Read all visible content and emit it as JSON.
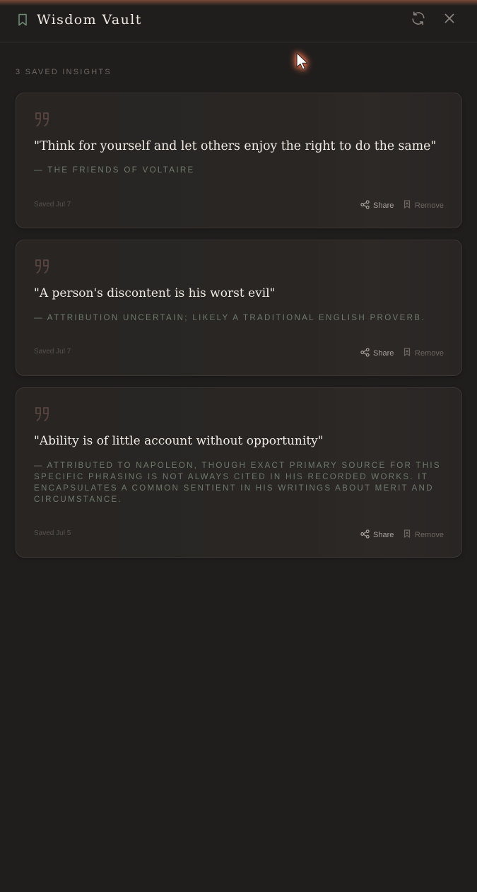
{
  "header": {
    "title": "Wisdom Vault",
    "bookmark_icon": "bookmark-icon",
    "refresh_icon": "refresh-icon",
    "close_icon": "close-icon"
  },
  "list": {
    "count_label": "3 SAVED INSIGHTS"
  },
  "quotes": [
    {
      "text": "\"Think for yourself and let others enjoy the right to do the same\"",
      "attribution": "— THE FRIENDS OF VOLTAIRE",
      "saved": "Saved Jul 7",
      "share_label": "Share",
      "remove_label": "Remove"
    },
    {
      "text": "\"A person's discontent is his worst evil\"",
      "attribution": "— ATTRIBUTION UNCERTAIN; LIKELY A TRADITIONAL ENGLISH PROVERB.",
      "saved": "Saved Jul 7",
      "share_label": "Share",
      "remove_label": "Remove"
    },
    {
      "text": "\"Ability is of little account without opportunity\"",
      "attribution": "— ATTRIBUTED TO NAPOLEON, THOUGH EXACT PRIMARY SOURCE FOR THIS SPECIFIC PHRASING IS NOT ALWAYS CITED IN HIS RECORDED WORKS. IT ENCAPSULATES A COMMON SENTIENT IN HIS WRITINGS ABOUT MERIT AND CIRCUMSTANCE.",
      "saved": "Saved Jul 5",
      "share_label": "Share",
      "remove_label": "Remove"
    }
  ],
  "colors": {
    "background": "#201e1d",
    "card_background": "#292624",
    "card_border": "#3b3633",
    "quote_text": "#f0ebe4",
    "attribution_text": "#6e7a6b",
    "quote_mark": "#5a4440",
    "bookmark_accent": "#6f8a74"
  }
}
